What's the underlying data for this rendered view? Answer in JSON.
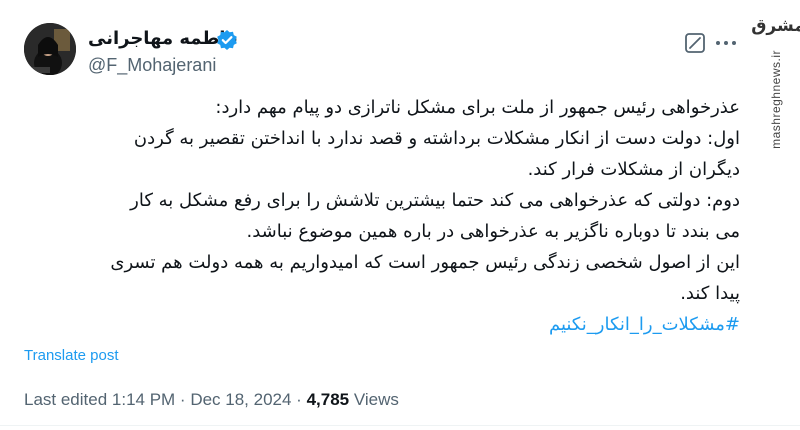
{
  "author": {
    "display_name": "فاطمه مهاجرانی",
    "handle": "@F_Mohajerani",
    "verified": true
  },
  "tweet": {
    "lines": [
      "عذرخواهی رئیس جمهور از ملت برای مشکل ناترازی دو پیام مهم دارد:",
      "اول: دولت دست از انکار مشکلات برداشته و قصد ندارد با انداختن تقصیر به گردن",
      "دیگران از مشکلات فرار کند.",
      "دوم:  دولتی که عذرخواهی می کند حتما بیشترین تلاشش را برای رفع مشکل به کار",
      "می بندد تا دوباره ناگزیر به عذرخواهی در باره همین موضوع نباشد.",
      "این از اصول شخصی زندگی رئیس جمهور است که امیدواریم به همه دولت هم تسری",
      "پیدا کند."
    ],
    "hashtag": "#مشکلات_را_انکار_نکنیم"
  },
  "actions": {
    "translate_label": "Translate post"
  },
  "meta": {
    "edited": "Last edited 1:14 PM · Dec 18, 2024 · ",
    "views_count": "4,785",
    "views_label": " Views"
  },
  "watermark": {
    "logo_text": "مشرق",
    "site": "mashreghnews.ir"
  },
  "colors": {
    "accent": "#1d9bf0",
    "secondary_text": "#536471",
    "primary_text": "#0f1419"
  },
  "icons": [
    "verified-badge-icon",
    "grok-icon",
    "more-options-icon"
  ]
}
